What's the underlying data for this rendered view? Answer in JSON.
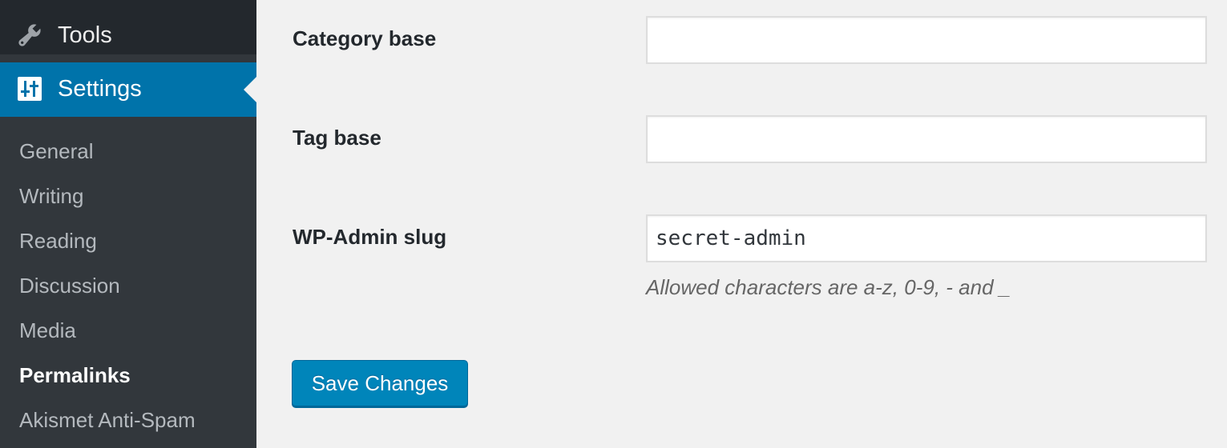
{
  "sidebar": {
    "tools_label": "Tools",
    "settings_label": "Settings",
    "submenu": [
      "General",
      "Writing",
      "Reading",
      "Discussion",
      "Media",
      "Permalinks",
      "Akismet Anti-Spam"
    ],
    "current_submenu": "Permalinks",
    "icons": {
      "tools": "wrench-icon",
      "settings": "settings-sliders-icon"
    }
  },
  "form": {
    "category_base_label": "Category base",
    "category_base_value": "",
    "tag_base_label": "Tag base",
    "tag_base_value": "",
    "wp_admin_slug_label": "WP-Admin slug",
    "wp_admin_slug_value": "secret-admin",
    "wp_admin_slug_hint": "Allowed characters are a-z, 0-9, - and _"
  },
  "save_label": "Save Changes",
  "colors": {
    "sidebar_bg": "#32373c",
    "active_menu_bg": "#0073aa",
    "button_bg": "#0085ba",
    "page_bg": "#f1f1f1"
  }
}
